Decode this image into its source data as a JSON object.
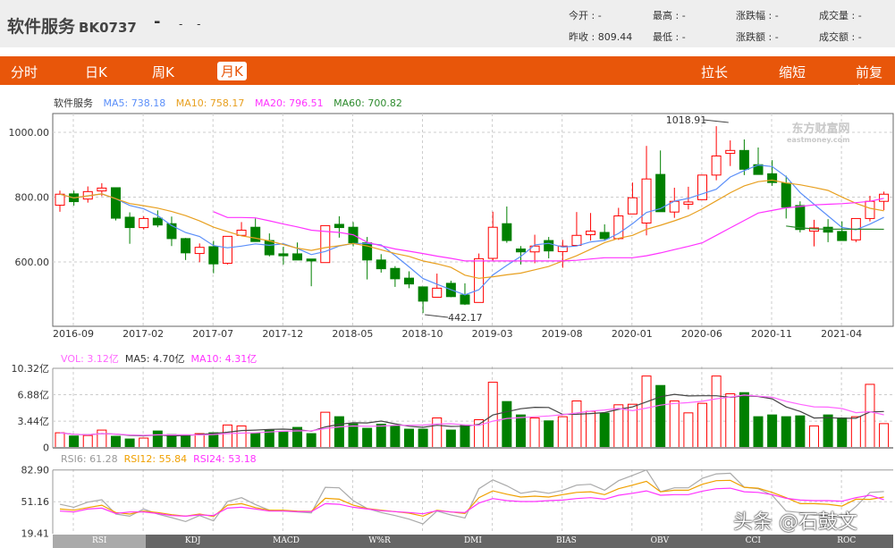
{
  "header": {
    "name": "软件服务",
    "code": "BK0737",
    "price": "-",
    "change": "- -",
    "quotes": [
      {
        "label": "今开",
        "value": "-"
      },
      {
        "label": "最高",
        "value": "-"
      },
      {
        "label": "涨跌幅",
        "value": "-"
      },
      {
        "label": "成交量",
        "value": "-"
      },
      {
        "label": "昨收",
        "value": "809.44"
      },
      {
        "label": "最低",
        "value": "-"
      },
      {
        "label": "涨跌额",
        "value": "-"
      },
      {
        "label": "成交额",
        "value": "-"
      }
    ]
  },
  "nav": {
    "left": [
      "分时",
      "日K",
      "周K",
      "月K"
    ],
    "active": "月K",
    "right": [
      "拉长",
      "缩短",
      "前复权"
    ]
  },
  "legend": {
    "name": "软件服务",
    "ma5": "MA5: 738.18",
    "ma10": "MA10: 758.17",
    "ma20": "MA20: 796.51",
    "ma60": "MA60: 700.82"
  },
  "vol_legend": {
    "vol": "VOL: 3.12亿",
    "ma5": "MA5: 4.70亿",
    "ma10": "MA10: 4.31亿"
  },
  "rsi_legend": {
    "rsi6": "RSI6: 61.28",
    "rsi12": "RSI12: 55.84",
    "rsi24": "RSI24: 53.18"
  },
  "tabs": [
    "RSI",
    "KDJ",
    "MACD",
    "W%R",
    "DMI",
    "BIAS",
    "OBV",
    "CCI",
    "ROC"
  ],
  "active_tab": "RSI",
  "logo": {
    "cn": "东方财富网",
    "en": "eastmoney.com"
  },
  "watermark": "头条 @石鼓文",
  "colors": {
    "up": "#ff0000",
    "down": "#008000",
    "ma5": "#5b8ff9",
    "ma10": "#e8a020",
    "ma20": "#ff33ff",
    "ma60": "#2e8b2e",
    "nav": "#e8560a"
  },
  "chart_data": {
    "type": "candlestick",
    "start_month": "2016-08",
    "x_ticks": [
      "2016-09",
      "2017-02",
      "2017-07",
      "2017-12",
      "2018-05",
      "2018-10",
      "2019-03",
      "2019-08",
      "2020-01",
      "2020-06",
      "2020-11",
      "2021-04"
    ],
    "y_ticks": [
      "1000.00",
      "800.00",
      "600.00"
    ],
    "ylim": [
      420,
      1070
    ],
    "annotations": [
      {
        "text": "1018.91",
        "index": 48
      },
      {
        "text": "442.17",
        "index": 26
      }
    ],
    "ohlc": [
      [
        775,
        820,
        755,
        809
      ],
      [
        810,
        820,
        774,
        786
      ],
      [
        794,
        833,
        783,
        817
      ],
      [
        819,
        843,
        803,
        828
      ],
      [
        829,
        829,
        728,
        735
      ],
      [
        738,
        753,
        656,
        706
      ],
      [
        706,
        741,
        700,
        734
      ],
      [
        735,
        759,
        707,
        714
      ],
      [
        718,
        740,
        649,
        672
      ],
      [
        672,
        674,
        606,
        628
      ],
      [
        626,
        657,
        599,
        645
      ],
      [
        647,
        665,
        565,
        594
      ],
      [
        596,
        679,
        592,
        679
      ],
      [
        682,
        723,
        682,
        698
      ],
      [
        707,
        734,
        663,
        663
      ],
      [
        666,
        688,
        617,
        622
      ],
      [
        625,
        647,
        592,
        619
      ],
      [
        625,
        660,
        606,
        606
      ],
      [
        609,
        609,
        525,
        603
      ],
      [
        598,
        712,
        598,
        712
      ],
      [
        716,
        741,
        675,
        706
      ],
      [
        707,
        723,
        648,
        659
      ],
      [
        659,
        677,
        546,
        606
      ],
      [
        606,
        624,
        567,
        579
      ],
      [
        580,
        587,
        523,
        548
      ],
      [
        550,
        571,
        519,
        532
      ],
      [
        523,
        523,
        442.17,
        479
      ],
      [
        491,
        564,
        491,
        519
      ],
      [
        534,
        542,
        491,
        493
      ],
      [
        498,
        534,
        467,
        470
      ],
      [
        475,
        626,
        475,
        610
      ],
      [
        611,
        755,
        603,
        707
      ],
      [
        718,
        771,
        659,
        666
      ],
      [
        640,
        649,
        592,
        631
      ],
      [
        631,
        684,
        596,
        649
      ],
      [
        666,
        677,
        611,
        634
      ],
      [
        632,
        668,
        582,
        649
      ],
      [
        651,
        754,
        651,
        682
      ],
      [
        684,
        751,
        666,
        695
      ],
      [
        691,
        716,
        666,
        672
      ],
      [
        672,
        767,
        668,
        742
      ],
      [
        748,
        845,
        748,
        798
      ],
      [
        720,
        958,
        682,
        856
      ],
      [
        870,
        944,
        755,
        755
      ],
      [
        754,
        829,
        736,
        787
      ],
      [
        778,
        832,
        762,
        785
      ],
      [
        792,
        868,
        792,
        868
      ],
      [
        868,
        1018.91,
        852,
        927
      ],
      [
        935,
        975,
        896,
        944
      ],
      [
        944,
        978,
        868,
        886
      ],
      [
        900,
        953,
        870,
        870
      ],
      [
        872,
        914,
        835,
        845
      ],
      [
        843,
        866,
        734,
        769
      ],
      [
        774,
        787,
        691,
        700
      ],
      [
        695,
        730,
        648,
        705
      ],
      [
        707,
        732,
        661,
        692
      ],
      [
        694,
        725,
        666,
        666
      ],
      [
        668,
        734,
        661,
        734
      ],
      [
        734,
        804,
        725,
        787
      ],
      [
        787,
        817,
        760,
        809
      ]
    ],
    "ma20": [
      null,
      null,
      null,
      null,
      null,
      null,
      null,
      null,
      null,
      null,
      null,
      755,
      737,
      737,
      736,
      727,
      717,
      708,
      698,
      694,
      691,
      684,
      661,
      650,
      640,
      633,
      626,
      618,
      611,
      603,
      603,
      603,
      603,
      603,
      603,
      603,
      603,
      605,
      609,
      613,
      613,
      613,
      619,
      628,
      638,
      648,
      659,
      682,
      705,
      728,
      751,
      759,
      767,
      771,
      776,
      778,
      780,
      783,
      787,
      796.51
    ],
    "ma60": [
      null,
      null,
      null,
      null,
      null,
      null,
      null,
      null,
      null,
      null,
      null,
      null,
      null,
      null,
      null,
      null,
      null,
      null,
      null,
      null,
      null,
      null,
      null,
      null,
      null,
      null,
      null,
      null,
      null,
      null,
      null,
      null,
      null,
      null,
      null,
      null,
      null,
      null,
      null,
      null,
      null,
      null,
      null,
      null,
      null,
      null,
      null,
      null,
      null,
      null,
      null,
      null,
      711,
      705,
      702,
      701,
      701,
      701,
      701,
      700.82
    ],
    "volume": {
      "unit": "亿",
      "y_ticks": [
        "10.32亿",
        "6.88亿",
        "3.44亿",
        "0"
      ],
      "ylim": [
        0,
        10.32
      ],
      "values": [
        1.93,
        1.51,
        1.58,
        2.28,
        1.47,
        1.12,
        1.24,
        2.16,
        1.7,
        1.62,
        1.82,
        1.93,
        2.94,
        2.82,
        1.89,
        2.28,
        2.09,
        2.63,
        1.82,
        4.6,
        4.02,
        3.09,
        2.51,
        3.05,
        2.82,
        2.4,
        2.4,
        3.86,
        2.28,
        2.94,
        3.63,
        8.5,
        5.99,
        4.25,
        3.86,
        3.48,
        4.02,
        6.07,
        4.72,
        4.48,
        5.57,
        5.64,
        9.31,
        8.08,
        6.07,
        4.52,
        5.76,
        9.31,
        7.0,
        7.15,
        4.02,
        4.25,
        4.02,
        4.13,
        2.82,
        4.25,
        3.86,
        4.02,
        8.23,
        3.12
      ]
    },
    "rsi": {
      "y_ticks": [
        "82.90",
        "51.16",
        "19.41"
      ],
      "ylim": [
        19.41,
        82.9
      ],
      "rsi6": [
        48.6,
        45.6,
        50.7,
        53.1,
        38.8,
        36.7,
        43.8,
        38.8,
        35.2,
        31.3,
        37.3,
        31.9,
        51.3,
        55.2,
        48.3,
        42.7,
        41.8,
        40.9,
        40.0,
        65.6,
        65.0,
        52.2,
        44.4,
        40.3,
        37.3,
        33.7,
        28.9,
        41.8,
        37.9,
        34.9,
        64.1,
        73.0,
        67.1,
        59.6,
        61.7,
        59.6,
        62.6,
        67.7,
        68.6,
        62.6,
        72.2,
        77.5,
        82.9,
        61.1,
        65.0,
        65.0,
        74.5,
        79.0,
        79.6,
        65.6,
        64.1,
        57.6,
        41.8,
        40.3,
        37.9,
        37.3,
        34.9,
        46.2,
        60.5,
        61.28
      ],
      "rsi12": [
        43.8,
        42.7,
        45.3,
        47.7,
        40.3,
        38.8,
        41.8,
        40.3,
        38.2,
        36.7,
        38.8,
        36.4,
        47.7,
        49.2,
        45.3,
        42.7,
        42.7,
        41.8,
        41.5,
        54.6,
        53.7,
        47.7,
        44.4,
        42.7,
        41.2,
        39.7,
        36.7,
        42.7,
        40.9,
        39.4,
        55.2,
        62.0,
        58.7,
        55.8,
        56.7,
        55.8,
        58.2,
        60.5,
        61.1,
        58.2,
        64.1,
        67.7,
        71.6,
        61.1,
        62.6,
        62.6,
        68.6,
        72.2,
        72.5,
        65.6,
        64.7,
        60.5,
        55.2,
        49.2,
        49.2,
        48.6,
        46.8,
        53.7,
        53.5,
        55.84
      ],
      "rsi24": [
        41.8,
        40.9,
        43.8,
        44.7,
        39.4,
        40.9,
        40.9,
        39.4,
        37.3,
        36.7,
        37.9,
        37.3,
        44.7,
        45.6,
        43.8,
        41.8,
        41.8,
        41.2,
        41.2,
        49.2,
        48.6,
        45.6,
        43.8,
        42.1,
        41.2,
        40.3,
        39.1,
        42.1,
        40.9,
        40.3,
        49.8,
        54.3,
        52.2,
        51.3,
        51.3,
        52.2,
        52.8,
        54.3,
        55.2,
        53.7,
        57.6,
        59.6,
        62.0,
        57.6,
        58.2,
        58.2,
        61.7,
        64.1,
        64.7,
        61.1,
        60.5,
        58.2,
        54.6,
        52.8,
        52.2,
        52.2,
        51.6,
        55.2,
        57.6,
        53.18
      ]
    }
  }
}
